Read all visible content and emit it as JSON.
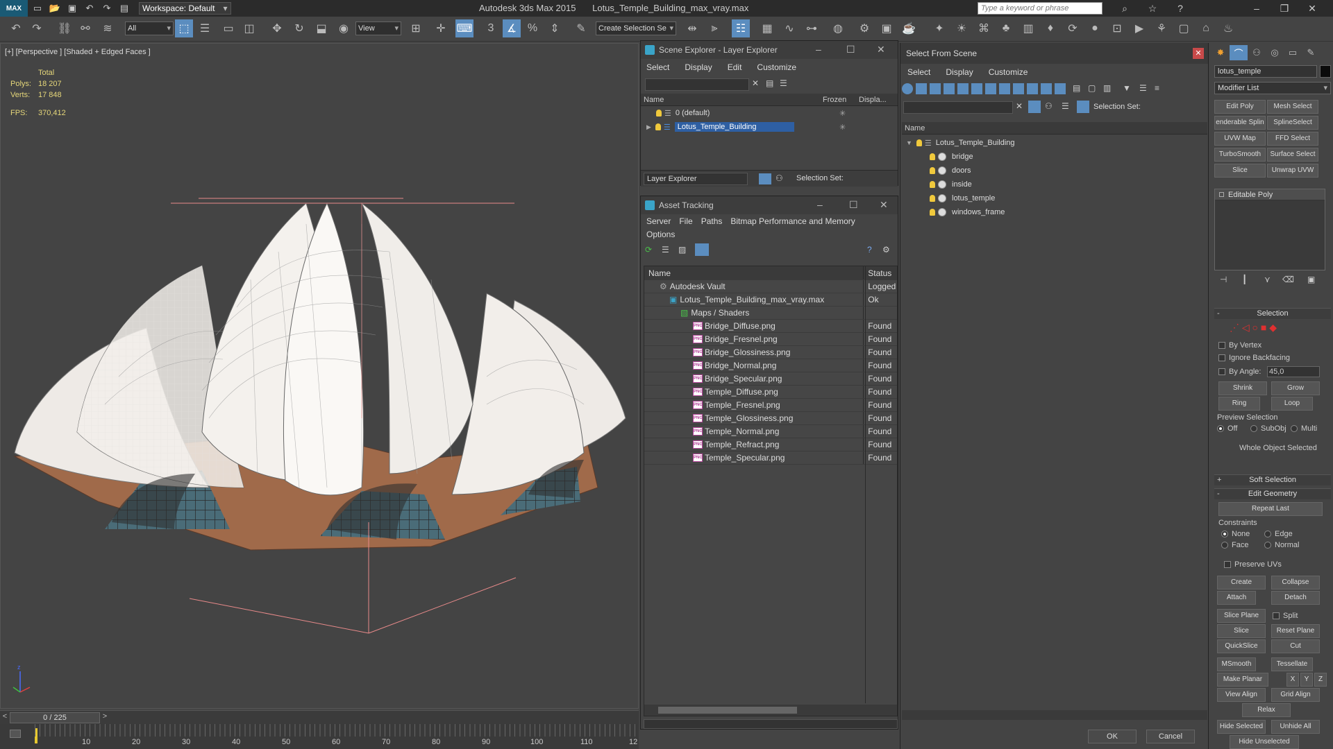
{
  "app": {
    "logo": "MAX",
    "workspace_label": "Workspace: Default",
    "product": "Autodesk 3ds Max  2015",
    "file": "Lotus_Temple_Building_max_vray.max",
    "search_placeholder": "Type a keyword or phrase"
  },
  "toolbar": {
    "filter": "All",
    "ref_coord": "View",
    "selection_set": "Create Selection Se"
  },
  "viewport": {
    "label": "[+] [Perspective ] [Shaded + Edged Faces ]",
    "stats_header": "Total",
    "polys_label": "Polys:",
    "polys_value": "18 207",
    "verts_label": "Verts:",
    "verts_value": "17 848",
    "fps_label": "FPS:",
    "fps_value": "370,412"
  },
  "timeline": {
    "frame": "0 / 225",
    "ticks": [
      "10",
      "20",
      "30",
      "40",
      "50",
      "60",
      "70",
      "80",
      "90",
      "100",
      "110",
      "12"
    ]
  },
  "scene_explorer": {
    "title": "Scene Explorer - Layer Explorer",
    "menu": [
      "Select",
      "Display",
      "Edit",
      "Customize"
    ],
    "col_name": "Name",
    "col_frozen": "Frozen",
    "col_display": "Displa...",
    "layers": [
      "0 (default)",
      "Lotus_Temple_Building"
    ],
    "footer_dropdown": "Layer Explorer",
    "footer_selset": "Selection Set:"
  },
  "asset_tracking": {
    "title": "Asset Tracking",
    "menu": [
      "Server",
      "File",
      "Paths",
      "Bitmap Performance and Memory"
    ],
    "menu2": "Options",
    "col_name": "Name",
    "col_status": "Status",
    "rows": [
      {
        "name": "Autodesk Vault",
        "status": "Logged"
      },
      {
        "name": "Lotus_Temple_Building_max_vray.max",
        "status": "Ok"
      },
      {
        "name": "Maps / Shaders",
        "status": ""
      },
      {
        "name": "Bridge_Diffuse.png",
        "status": "Found"
      },
      {
        "name": "Bridge_Fresnel.png",
        "status": "Found"
      },
      {
        "name": "Bridge_Glossiness.png",
        "status": "Found"
      },
      {
        "name": "Bridge_Normal.png",
        "status": "Found"
      },
      {
        "name": "Bridge_Specular.png",
        "status": "Found"
      },
      {
        "name": "Temple_Diffuse.png",
        "status": "Found"
      },
      {
        "name": "Temple_Fresnel.png",
        "status": "Found"
      },
      {
        "name": "Temple_Glossiness.png",
        "status": "Found"
      },
      {
        "name": "Temple_Normal.png",
        "status": "Found"
      },
      {
        "name": "Temple_Refract.png",
        "status": "Found"
      },
      {
        "name": "Temple_Specular.png",
        "status": "Found"
      }
    ],
    "png_badge": "PNG"
  },
  "select_from_scene": {
    "title": "Select From Scene",
    "menu": [
      "Select",
      "Display",
      "Customize"
    ],
    "selset_label": "Selection Set:",
    "col_name": "Name",
    "root": "Lotus_Temple_Building",
    "children": [
      "bridge",
      "doors",
      "inside",
      "lotus_temple",
      "windows_frame"
    ],
    "ok": "OK",
    "cancel": "Cancel"
  },
  "command_panel": {
    "object_name": "lotus_temple",
    "modifier_list": "Modifier List",
    "mod_buttons": [
      "Edit Poly",
      "Mesh Select",
      "enderable Splin",
      "SplineSelect",
      "UVW Map",
      "FFD Select",
      "TurboSmooth",
      "Surface Select",
      "Slice",
      "Unwrap UVW"
    ],
    "stack_item": "Editable Poly",
    "selection_title": "Selection",
    "by_vertex": "By Vertex",
    "ignore_backfacing": "Ignore Backfacing",
    "by_angle": "By Angle:",
    "angle_value": "45,0",
    "shrink": "Shrink",
    "grow": "Grow",
    "ring": "Ring",
    "loop": "Loop",
    "preview_selection": "Preview Selection",
    "preview_off": "Off",
    "preview_subobj": "SubObj",
    "preview_multi": "Multi",
    "whole_object": "Whole Object Selected",
    "soft_selection": "Soft Selection",
    "edit_geometry": "Edit Geometry",
    "repeat_last": "Repeat Last",
    "constraints": "Constraints",
    "c_none": "None",
    "c_edge": "Edge",
    "c_face": "Face",
    "c_normal": "Normal",
    "preserve_uvs": "Preserve UVs",
    "create": "Create",
    "collapse": "Collapse",
    "attach": "Attach",
    "detach": "Detach",
    "slice_plane": "Slice Plane",
    "split": "Split",
    "slice": "Slice",
    "reset_plane": "Reset Plane",
    "quickslice": "QuickSlice",
    "cut": "Cut",
    "msmooth": "MSmooth",
    "tessellate": "Tessellate",
    "make_planar": "Make Planar",
    "x": "X",
    "y": "Y",
    "z": "Z",
    "view_align": "View Align",
    "grid_align": "Grid Align",
    "relax": "Relax",
    "hide_selected": "Hide Selected",
    "unhide_all": "Unhide All",
    "hide_unselected": "Hide Unselected"
  }
}
